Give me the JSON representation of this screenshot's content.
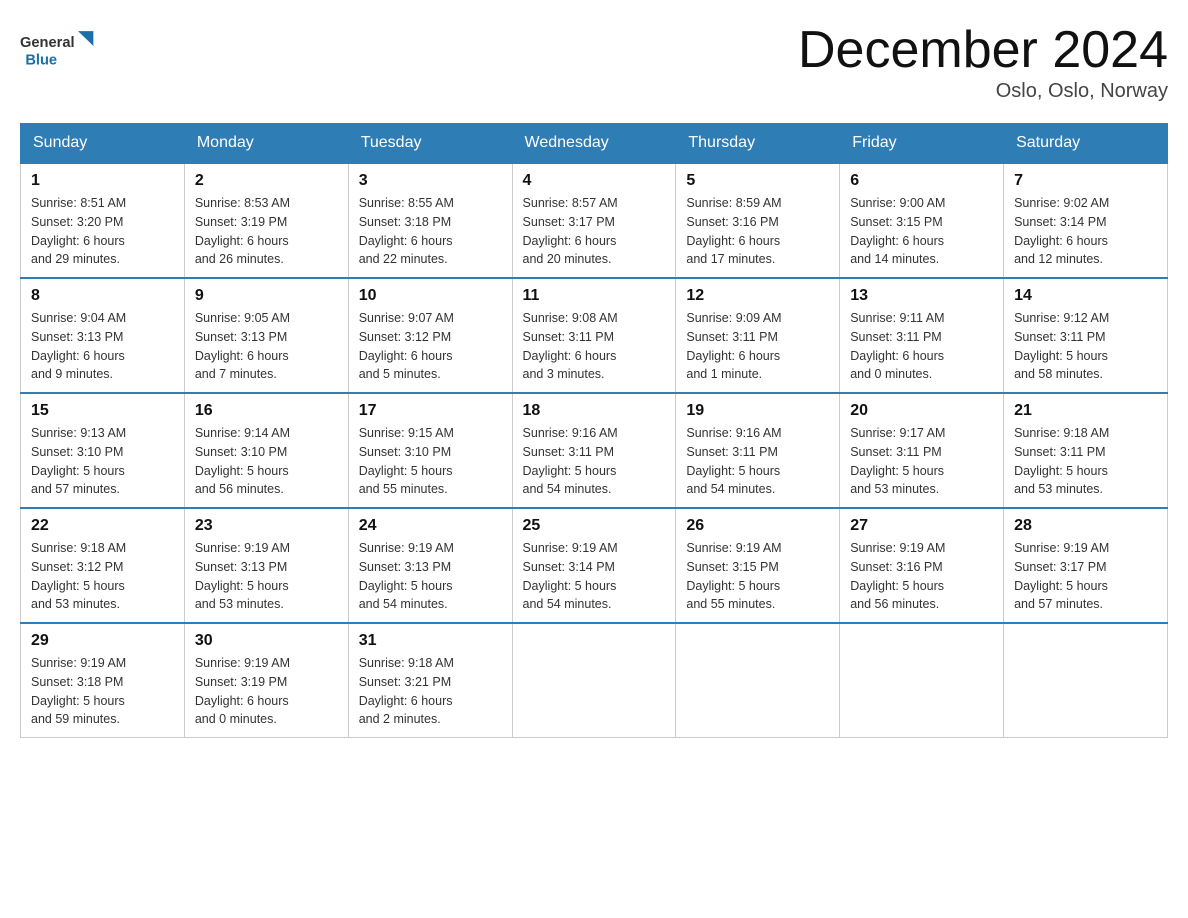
{
  "header": {
    "logo_general": "General",
    "logo_blue": "Blue",
    "month_title": "December 2024",
    "location": "Oslo, Oslo, Norway"
  },
  "days_of_week": [
    "Sunday",
    "Monday",
    "Tuesday",
    "Wednesday",
    "Thursday",
    "Friday",
    "Saturday"
  ],
  "weeks": [
    [
      {
        "day": "1",
        "sunrise": "8:51 AM",
        "sunset": "3:20 PM",
        "daylight": "6 hours and 29 minutes."
      },
      {
        "day": "2",
        "sunrise": "8:53 AM",
        "sunset": "3:19 PM",
        "daylight": "6 hours and 26 minutes."
      },
      {
        "day": "3",
        "sunrise": "8:55 AM",
        "sunset": "3:18 PM",
        "daylight": "6 hours and 22 minutes."
      },
      {
        "day": "4",
        "sunrise": "8:57 AM",
        "sunset": "3:17 PM",
        "daylight": "6 hours and 20 minutes."
      },
      {
        "day": "5",
        "sunrise": "8:59 AM",
        "sunset": "3:16 PM",
        "daylight": "6 hours and 17 minutes."
      },
      {
        "day": "6",
        "sunrise": "9:00 AM",
        "sunset": "3:15 PM",
        "daylight": "6 hours and 14 minutes."
      },
      {
        "day": "7",
        "sunrise": "9:02 AM",
        "sunset": "3:14 PM",
        "daylight": "6 hours and 12 minutes."
      }
    ],
    [
      {
        "day": "8",
        "sunrise": "9:04 AM",
        "sunset": "3:13 PM",
        "daylight": "6 hours and 9 minutes."
      },
      {
        "day": "9",
        "sunrise": "9:05 AM",
        "sunset": "3:13 PM",
        "daylight": "6 hours and 7 minutes."
      },
      {
        "day": "10",
        "sunrise": "9:07 AM",
        "sunset": "3:12 PM",
        "daylight": "6 hours and 5 minutes."
      },
      {
        "day": "11",
        "sunrise": "9:08 AM",
        "sunset": "3:11 PM",
        "daylight": "6 hours and 3 minutes."
      },
      {
        "day": "12",
        "sunrise": "9:09 AM",
        "sunset": "3:11 PM",
        "daylight": "6 hours and 1 minute."
      },
      {
        "day": "13",
        "sunrise": "9:11 AM",
        "sunset": "3:11 PM",
        "daylight": "6 hours and 0 minutes."
      },
      {
        "day": "14",
        "sunrise": "9:12 AM",
        "sunset": "3:11 PM",
        "daylight": "5 hours and 58 minutes."
      }
    ],
    [
      {
        "day": "15",
        "sunrise": "9:13 AM",
        "sunset": "3:10 PM",
        "daylight": "5 hours and 57 minutes."
      },
      {
        "day": "16",
        "sunrise": "9:14 AM",
        "sunset": "3:10 PM",
        "daylight": "5 hours and 56 minutes."
      },
      {
        "day": "17",
        "sunrise": "9:15 AM",
        "sunset": "3:10 PM",
        "daylight": "5 hours and 55 minutes."
      },
      {
        "day": "18",
        "sunrise": "9:16 AM",
        "sunset": "3:11 PM",
        "daylight": "5 hours and 54 minutes."
      },
      {
        "day": "19",
        "sunrise": "9:16 AM",
        "sunset": "3:11 PM",
        "daylight": "5 hours and 54 minutes."
      },
      {
        "day": "20",
        "sunrise": "9:17 AM",
        "sunset": "3:11 PM",
        "daylight": "5 hours and 53 minutes."
      },
      {
        "day": "21",
        "sunrise": "9:18 AM",
        "sunset": "3:11 PM",
        "daylight": "5 hours and 53 minutes."
      }
    ],
    [
      {
        "day": "22",
        "sunrise": "9:18 AM",
        "sunset": "3:12 PM",
        "daylight": "5 hours and 53 minutes."
      },
      {
        "day": "23",
        "sunrise": "9:19 AM",
        "sunset": "3:13 PM",
        "daylight": "5 hours and 53 minutes."
      },
      {
        "day": "24",
        "sunrise": "9:19 AM",
        "sunset": "3:13 PM",
        "daylight": "5 hours and 54 minutes."
      },
      {
        "day": "25",
        "sunrise": "9:19 AM",
        "sunset": "3:14 PM",
        "daylight": "5 hours and 54 minutes."
      },
      {
        "day": "26",
        "sunrise": "9:19 AM",
        "sunset": "3:15 PM",
        "daylight": "5 hours and 55 minutes."
      },
      {
        "day": "27",
        "sunrise": "9:19 AM",
        "sunset": "3:16 PM",
        "daylight": "5 hours and 56 minutes."
      },
      {
        "day": "28",
        "sunrise": "9:19 AM",
        "sunset": "3:17 PM",
        "daylight": "5 hours and 57 minutes."
      }
    ],
    [
      {
        "day": "29",
        "sunrise": "9:19 AM",
        "sunset": "3:18 PM",
        "daylight": "5 hours and 59 minutes."
      },
      {
        "day": "30",
        "sunrise": "9:19 AM",
        "sunset": "3:19 PM",
        "daylight": "6 hours and 0 minutes."
      },
      {
        "day": "31",
        "sunrise": "9:18 AM",
        "sunset": "3:21 PM",
        "daylight": "6 hours and 2 minutes."
      },
      null,
      null,
      null,
      null
    ]
  ],
  "labels": {
    "sunrise": "Sunrise:",
    "sunset": "Sunset:",
    "daylight": "Daylight:"
  },
  "colors": {
    "header_bg": "#2e7db5",
    "border": "#2e7db5",
    "logo_dark": "#333333",
    "logo_blue": "#1a6fa8"
  }
}
